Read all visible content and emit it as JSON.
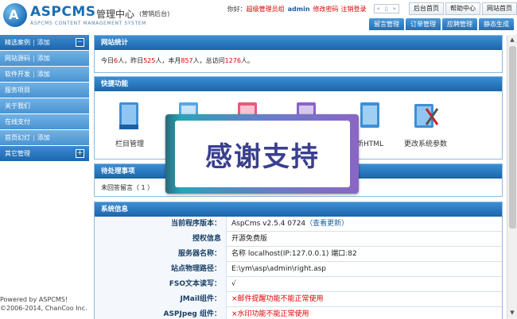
{
  "header": {
    "logo_mark": "A",
    "logo_name": "ASPCMS",
    "logo_title": "管理中心",
    "logo_subtitle": "(营销后台)",
    "logo_english": "ASPCMS CONTENT MANAGEMENT SYSTEM",
    "greeting": "你好：",
    "role": "超级管理员组",
    "username": "admin",
    "change_password": "修改密码",
    "logout": "注销登录",
    "nav_arrows": [
      "«",
      "▯",
      "»"
    ],
    "top_buttons": [
      "后台首页",
      "帮助中心",
      "网站首页"
    ],
    "tabs": [
      "留言管理",
      "订单管理",
      "应聘管理",
      "静态生成"
    ]
  },
  "sidebar": {
    "items": [
      {
        "label": "精选案例",
        "add": "添加",
        "toggle": "−",
        "sub": false
      },
      {
        "label": "网站源码",
        "add": "添加",
        "toggle": "",
        "sub": true
      },
      {
        "label": "软件开发",
        "add": "添加",
        "toggle": "",
        "sub": true
      },
      {
        "label": "服务项目",
        "add": "",
        "toggle": "",
        "sub": true
      },
      {
        "label": "关于我们",
        "add": "",
        "toggle": "",
        "sub": true
      },
      {
        "label": "在线支付",
        "add": "",
        "toggle": "",
        "sub": true
      },
      {
        "label": "首页幻灯",
        "add": "添加",
        "toggle": "",
        "sub": true
      },
      {
        "label": "其它管理",
        "add": "",
        "toggle": "+",
        "sub": false
      }
    ],
    "footer_line1": "Powered by ASPCMS!",
    "footer_line2": "©2006-2014, ChanCoo Inc."
  },
  "stats": {
    "title": "网站统计",
    "today_label": "今日",
    "today_value": "6",
    "yesterday_label": "人，昨日",
    "yesterday_value": "525",
    "month_label": "人，本月",
    "month_value": "857",
    "total_label": "人，总访问",
    "total_value": "1276",
    "suffix": "人。",
    "unit_before_yesterday": ""
  },
  "quick": {
    "title": "快捷功能",
    "items": [
      {
        "label": "栏目管理",
        "icon": "book-icon"
      },
      {
        "label": "",
        "icon": "document-icon"
      },
      {
        "label": "",
        "icon": "document-icon"
      },
      {
        "label": "",
        "icon": "document-icon"
      },
      {
        "label": "新HTML",
        "icon": "html-icon"
      },
      {
        "label": "更改系统参数",
        "icon": "settings-book-icon"
      }
    ]
  },
  "todo": {
    "title": "待处理事项",
    "text": "未回答留言（ 1 ）",
    "text2": "未"
  },
  "sysinfo": {
    "title": "系统信息",
    "rows": [
      {
        "k": "当前程序版本：",
        "v": "AspCms v2.5.4 0724",
        "link": "（查看更新）",
        "warn": false
      },
      {
        "k": "授权信息",
        "v": "开源免费版",
        "link": "",
        "warn": false
      },
      {
        "k": "服务器名称：",
        "v": "名称 localhost(IP:127.0.0.1) 端口:82",
        "link": "",
        "warn": false
      },
      {
        "k": "站点物理路径：",
        "v": "E:\\ym\\asp\\admin\\right.asp",
        "link": "",
        "warn": false
      },
      {
        "k": "FSO文本读写：",
        "v": "√",
        "link": "",
        "warn": false
      },
      {
        "k": "JMail组件：",
        "v": "×邮件提醒功能不能正常使用",
        "link": "",
        "warn": true
      },
      {
        "k": "ASPJpeg 组件：",
        "v": "×水印功能不能正常使用",
        "link": "",
        "warn": true
      }
    ]
  },
  "overlay": {
    "message": "感谢支持"
  },
  "colors": {
    "brand_blue": "#1b6db3",
    "warn_red": "#dd0000"
  }
}
